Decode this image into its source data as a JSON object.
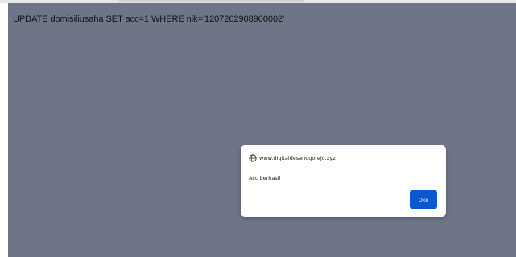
{
  "page": {
    "query_text": "UPDATE domisiliusaha SET acc=1 WHERE nik='1207262908900002'"
  },
  "dialog": {
    "origin": "www.digitaldesanogorejo.xyz",
    "message": "Acc berhasil",
    "ok_label": "Oke",
    "origin_icon": "globe-icon"
  },
  "colors": {
    "overlay": "#6e7587",
    "button": "#0b57d0",
    "dialog_bg": "#ffffff"
  }
}
